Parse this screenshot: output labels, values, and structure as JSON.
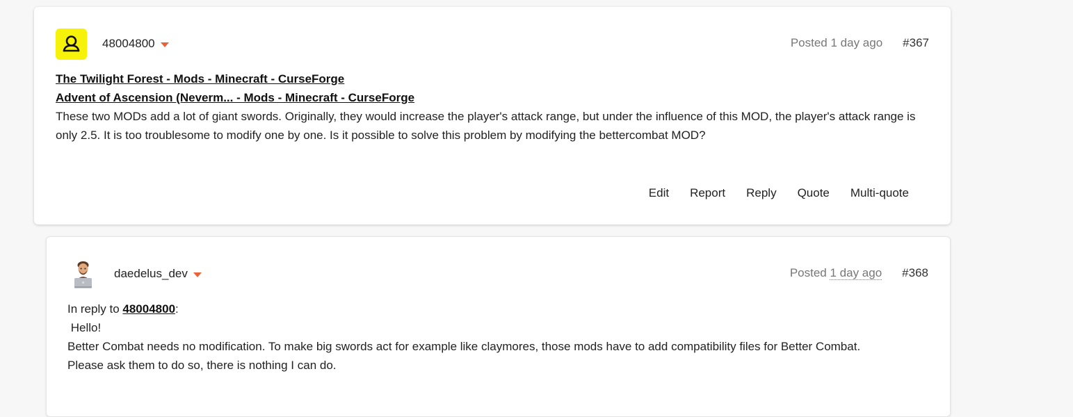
{
  "posts": [
    {
      "username": "48004800",
      "avatar_icon": "user-outline-icon",
      "avatar_color": "#f6f20a",
      "posted_label": "Posted",
      "posted_time": "1 day ago",
      "number": "#367",
      "links": [
        "The Twilight Forest - Mods - Minecraft - CurseForge",
        "Advent of Ascension (Neverm... - Mods - Minecraft - CurseForge"
      ],
      "text": "These two MODs add a lot of giant swords. Originally, they would increase the player's attack range, but under the influence of this MOD, the player's attack range is only 2.5. It is too troublesome to modify one by one. Is it possible to solve this problem by modifying the bettercombat MOD?",
      "actions": [
        "Edit",
        "Report",
        "Reply",
        "Quote",
        "Multi-quote"
      ]
    },
    {
      "username": "daedelus_dev",
      "avatar_icon": "memoji-laptop-icon",
      "posted_label": "Posted",
      "posted_time": "1 day ago",
      "number": "#368",
      "reply_prefix": "In reply to",
      "reply_user": "48004800",
      "reply_suffix": ":",
      "greeting": " Hello!",
      "text_line1": "Better Combat needs no modification. To make big swords act for example like claymores, those mods have to add compatibility files for Better Combat.",
      "text_line2": "Please ask them to do so, there is nothing I can do."
    }
  ],
  "colors": {
    "accent": "#e8623a",
    "background": "#f7f7f7"
  }
}
